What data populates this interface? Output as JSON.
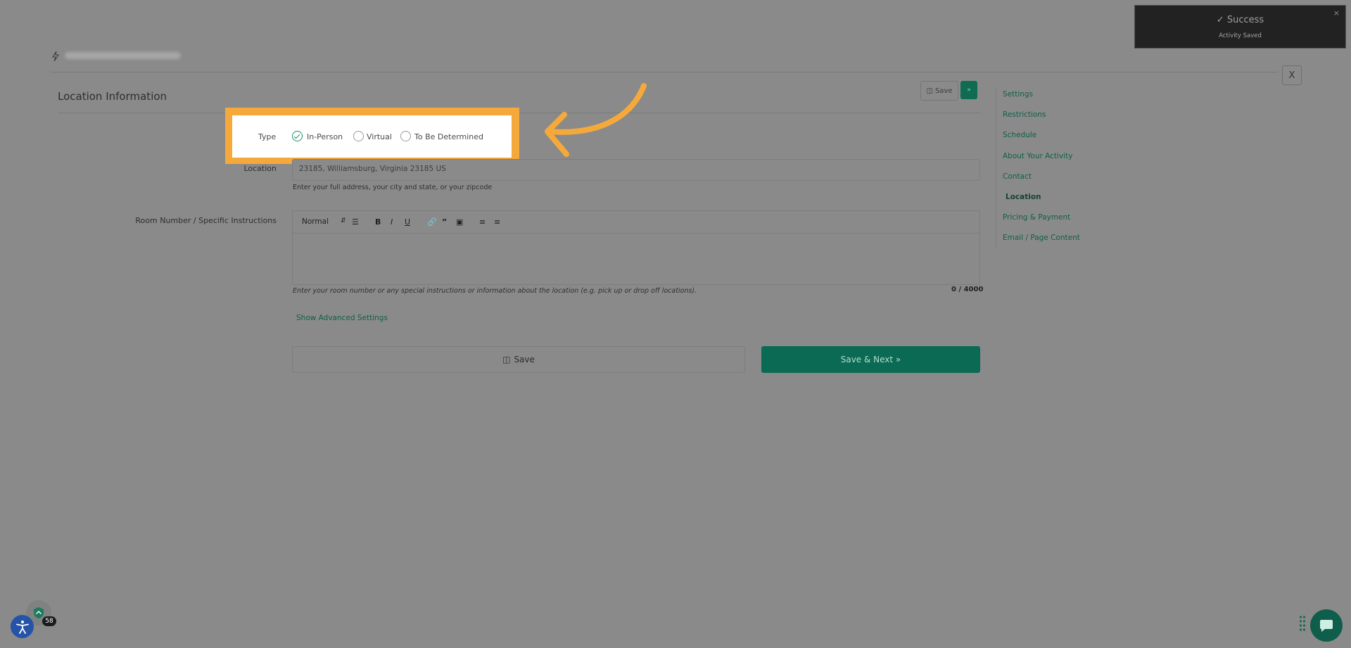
{
  "header": {
    "close_label": "X"
  },
  "section": {
    "title": "Location Information"
  },
  "top_actions": {
    "save_label": "Save",
    "next_label": "»"
  },
  "sidenav": {
    "items": [
      {
        "label": "Settings"
      },
      {
        "label": "Restrictions"
      },
      {
        "label": "Schedule"
      },
      {
        "label": "About Your Activity"
      },
      {
        "label": "Contact"
      },
      {
        "label": "Location",
        "active": true
      },
      {
        "label": "Pricing & Payment"
      },
      {
        "label": "Email / Page Content"
      }
    ]
  },
  "type_field": {
    "label": "Type",
    "options": [
      {
        "label": "In-Person",
        "checked": true
      },
      {
        "label": "Virtual",
        "checked": false
      },
      {
        "label": "To Be Determined",
        "checked": false
      }
    ]
  },
  "location_field": {
    "label": "Location",
    "value": "23185, Williamsburg, Virginia 23185 US",
    "hint": "Enter your full address, your city and state, or your zipcode"
  },
  "room_field": {
    "label": "Room Number / Specific Instructions",
    "format_select": "Normal",
    "hint": "Enter your room number or any special instructions or information about the location (e.g. pick up or drop off locations).",
    "counter": "0 / 4000"
  },
  "advanced_link": "Show Advanced Settings",
  "buttons": {
    "save": "Save",
    "save_next": "Save & Next »"
  },
  "toast": {
    "title": "Success",
    "message": "Activity Saved",
    "close": "×"
  },
  "widgets": {
    "badge_count": "58"
  },
  "colors": {
    "accent": "#0a6a53",
    "highlight": "#f6a93b",
    "arrow": "#f6a93b"
  }
}
